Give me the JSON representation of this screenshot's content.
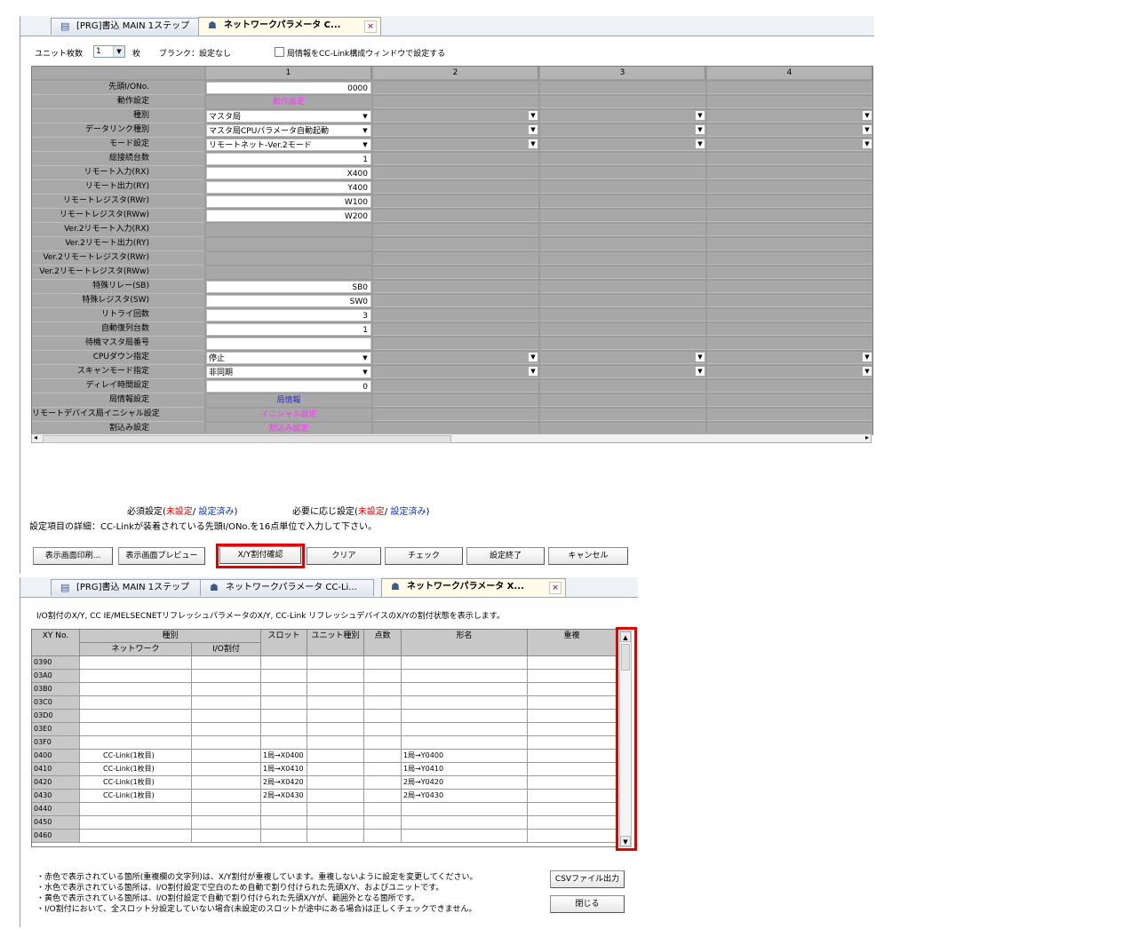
{
  "panel1": {
    "tabs": [
      {
        "label": "[PRG]書込 MAIN 1ステップ",
        "icon": "program-icon"
      },
      {
        "label": "ネットワークパラメータ C...",
        "icon": "network-param-icon",
        "close": "×"
      }
    ],
    "unit_count_label": "ユニット枚数",
    "unit_count_value": "1",
    "unit_count_suffix": "枚",
    "blank_note": "ブランク：設定なし",
    "station_info_checkbox_label": "局情報をCC-Link構成ウィンドウで設定する",
    "column_headers": [
      "1",
      "2",
      "3",
      "4"
    ],
    "rows": [
      {
        "label": "先頭I/ONo.",
        "value": "0000",
        "kind": "text"
      },
      {
        "label": "動作設定",
        "value": "動作設定",
        "kind": "link"
      },
      {
        "label": "種別",
        "value": "マスタ局",
        "kind": "combo"
      },
      {
        "label": "データリンク種別",
        "value": "マスタ局CPUパラメータ自動起動",
        "kind": "combo"
      },
      {
        "label": "モード設定",
        "value": "リモートネット-Ver.2モード",
        "kind": "combo"
      },
      {
        "label": "総接続台数",
        "value": "1",
        "kind": "text"
      },
      {
        "label": "リモート入力(RX)",
        "value": "X400",
        "kind": "text"
      },
      {
        "label": "リモート出力(RY)",
        "value": "Y400",
        "kind": "text"
      },
      {
        "label": "リモートレジスタ(RWr)",
        "value": "W100",
        "kind": "text"
      },
      {
        "label": "リモートレジスタ(RWw)",
        "value": "W200",
        "kind": "text"
      },
      {
        "label": "Ver.2リモート入力(RX)",
        "value": "",
        "kind": "gray"
      },
      {
        "label": "Ver.2リモート出力(RY)",
        "value": "",
        "kind": "gray"
      },
      {
        "label": "Ver.2リモートレジスタ(RWr)",
        "value": "",
        "kind": "gray"
      },
      {
        "label": "Ver.2リモートレジスタ(RWw)",
        "value": "",
        "kind": "gray"
      },
      {
        "label": "特殊リレー(SB)",
        "value": "SB0",
        "kind": "text"
      },
      {
        "label": "特殊レジスタ(SW)",
        "value": "SW0",
        "kind": "text"
      },
      {
        "label": "リトライ回数",
        "value": "3",
        "kind": "text"
      },
      {
        "label": "自動復列台数",
        "value": "1",
        "kind": "text"
      },
      {
        "label": "待機マスタ局番号",
        "value": "",
        "kind": "text"
      },
      {
        "label": "CPUダウン指定",
        "value": "停止",
        "kind": "combo"
      },
      {
        "label": "スキャンモード指定",
        "value": "非同期",
        "kind": "combo"
      },
      {
        "label": "ディレイ時間設定",
        "value": "0",
        "kind": "text"
      },
      {
        "label": "局情報設定",
        "value": "局情報",
        "kind": "link2"
      },
      {
        "label": "リモートデバイス局イニシャル設定",
        "value": "イニシャル設定",
        "kind": "link"
      },
      {
        "label": "割込み設定",
        "value": "割込み設定",
        "kind": "link"
      }
    ],
    "legend": {
      "required_prefix": "必須設定(",
      "unset": "未設定",
      "slash": "/",
      "done": "設定済み",
      "close_paren": ")",
      "optional_prefix": "必要に応じ設定("
    },
    "detail_text": "設定項目の詳細：CC-Linkが装着されている先頭I/ONo.を16点単位で入力して下さい。",
    "buttons": [
      "表示画面印刷...",
      "表示画面プレビュー",
      "X/Y割付確認",
      "クリア",
      "チェック",
      "設定終了",
      "キャンセル"
    ]
  },
  "panel2": {
    "tabs": [
      {
        "label": "[PRG]書込 MAIN 1ステップ",
        "icon": "program-icon"
      },
      {
        "label": "ネットワークパラメータ CC-Li...",
        "icon": "network-param-icon"
      },
      {
        "label": "ネットワークパラメータ X...",
        "icon": "network-param-icon",
        "close": "×"
      }
    ],
    "description": "I/O割付のX/Y, CC IE/MELSECNETリフレッシュパラメータのX/Y, CC-Link リフレッシュデバイスのX/Yの割付状態を表示します。",
    "headers": {
      "xy": "XY No.",
      "type": "種別",
      "network": "ネットワーク",
      "io": "I/O割付",
      "slot": "スロット",
      "unit_type": "ユニット種別",
      "points": "点数",
      "model": "形名",
      "dup": "重複"
    },
    "rows": [
      {
        "xy": "0390",
        "network": "",
        "slot": "",
        "model": ""
      },
      {
        "xy": "03A0",
        "network": "",
        "slot": "",
        "model": ""
      },
      {
        "xy": "03B0",
        "network": "",
        "slot": "",
        "model": ""
      },
      {
        "xy": "03C0",
        "network": "",
        "slot": "",
        "model": ""
      },
      {
        "xy": "03D0",
        "network": "",
        "slot": "",
        "model": ""
      },
      {
        "xy": "03E0",
        "network": "",
        "slot": "",
        "model": ""
      },
      {
        "xy": "03F0",
        "network": "",
        "slot": "",
        "model": ""
      },
      {
        "xy": "0400",
        "network": "CC-Link(1枚目)",
        "slot": "1局→X0400",
        "model": "1局→Y0400"
      },
      {
        "xy": "0410",
        "network": "CC-Link(1枚目)",
        "slot": "1局→X0410",
        "model": "1局→Y0410"
      },
      {
        "xy": "0420",
        "network": "CC-Link(1枚目)",
        "slot": "2局→X0420",
        "model": "2局→Y0420"
      },
      {
        "xy": "0430",
        "network": "CC-Link(1枚目)",
        "slot": "2局→X0430",
        "model": "2局→Y0430"
      },
      {
        "xy": "0440",
        "network": "",
        "slot": "",
        "model": ""
      },
      {
        "xy": "0450",
        "network": "",
        "slot": "",
        "model": ""
      },
      {
        "xy": "0460",
        "network": "",
        "slot": "",
        "model": ""
      }
    ],
    "notes": [
      "・赤色で表示されている箇所(重複欄の文字列)は、X/Y割付が重複しています。重複しないように設定を変更してください。",
      "・水色で表示されている箇所は、I/O割付設定で空白のため自動で割り付けられた先頭X/Y、およびユニットです。",
      "・黄色で表示されている箇所は、I/O割付設定で自動で割り付けられた先頭X/Yが、範囲外となる箇所です。",
      "・I/O割付において、全スロット分設定していない場合(未設定のスロットが途中にある場合)は正しくチェックできません。"
    ],
    "csv_button": "CSVファイル出力",
    "close_button": "閉じる"
  }
}
